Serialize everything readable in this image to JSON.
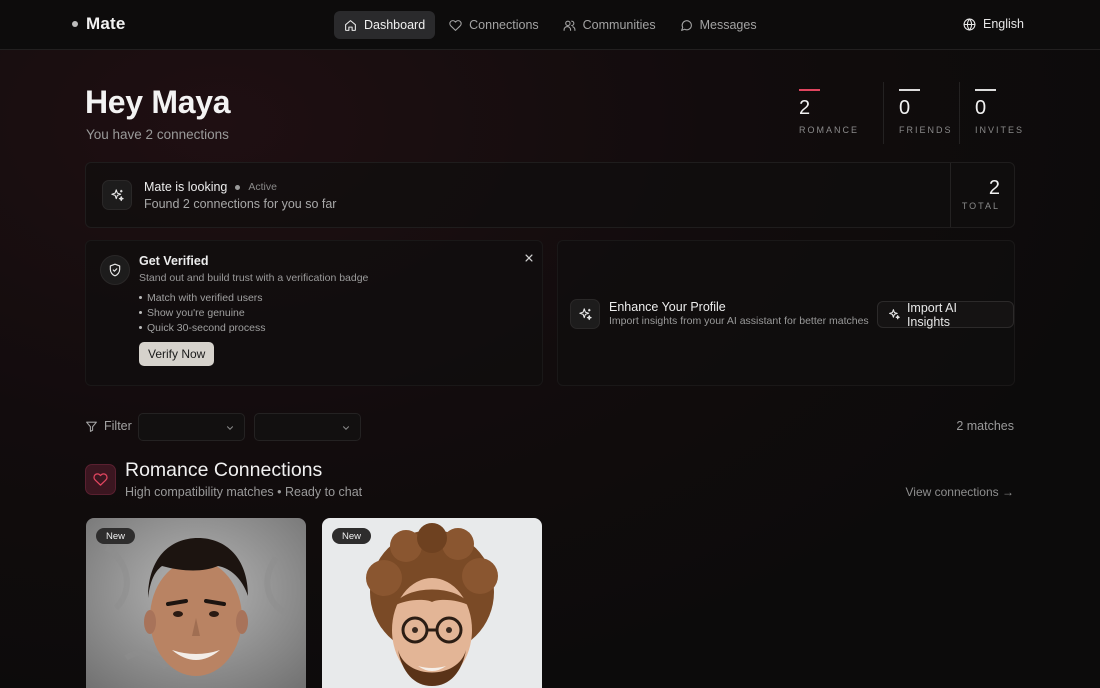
{
  "app": {
    "name": "Mate"
  },
  "nav": {
    "items": [
      {
        "label": "Dashboard",
        "icon": "home-icon",
        "active": true
      },
      {
        "label": "Connections",
        "icon": "heart-icon",
        "active": false
      },
      {
        "label": "Communities",
        "icon": "users-icon",
        "active": false
      },
      {
        "label": "Messages",
        "icon": "message-icon",
        "active": false
      }
    ],
    "language": "English"
  },
  "hero": {
    "greeting": "Hey Maya",
    "subtitle": "You have 2 connections"
  },
  "stats": [
    {
      "value": "2",
      "label": "ROMANCE",
      "accent": "#e0455f"
    },
    {
      "value": "0",
      "label": "FRIENDS"
    },
    {
      "value": "0",
      "label": "INVITES"
    }
  ],
  "looking": {
    "title": "Mate is looking",
    "status": "Active",
    "subtitle": "Found 2 connections for you so far",
    "total_value": "2",
    "total_label": "TOTAL"
  },
  "verify": {
    "title": "Get Verified",
    "subtitle": "Stand out and build trust with a verification badge",
    "bullets": [
      "Match with verified users",
      "Show you're genuine",
      "Quick 30-second process"
    ],
    "button": "Verify Now"
  },
  "enhance": {
    "title": "Enhance Your Profile",
    "subtitle": "Import insights from your AI assistant for better matches",
    "button": "Import AI Insights"
  },
  "filter": {
    "label": "Filter",
    "select_1": "",
    "select_2": "",
    "matches": "2 matches"
  },
  "section": {
    "title": "Romance Connections",
    "subtitle": "High compatibility matches  •  Ready to chat",
    "link": "View connections →"
  },
  "profiles": [
    {
      "badge": "New"
    },
    {
      "badge": "New"
    }
  ],
  "colors": {
    "accent": "#e0455f",
    "background": "#0c0b0b",
    "button_light": "#d6d2cc"
  }
}
